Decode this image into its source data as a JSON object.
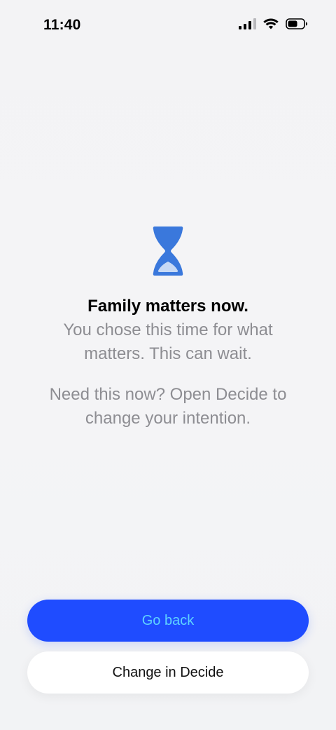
{
  "status_bar": {
    "time": "11:40",
    "icons": [
      "cellular-signal-icon",
      "wifi-icon",
      "battery-icon"
    ]
  },
  "main": {
    "icon": "hourglass-icon",
    "title": "Family matters now.",
    "subtitle": "You chose this time for what matters. This can wait.",
    "hint": "Need this now? Open Decide to change your intention."
  },
  "actions": {
    "primary_label": "Go back",
    "secondary_label": "Change in Decide"
  },
  "colors": {
    "accent": "#1f4cff",
    "primary_text": "#5fd3ff",
    "icon_blue": "#3a78dc",
    "secondary_text": "#8d8d92"
  }
}
